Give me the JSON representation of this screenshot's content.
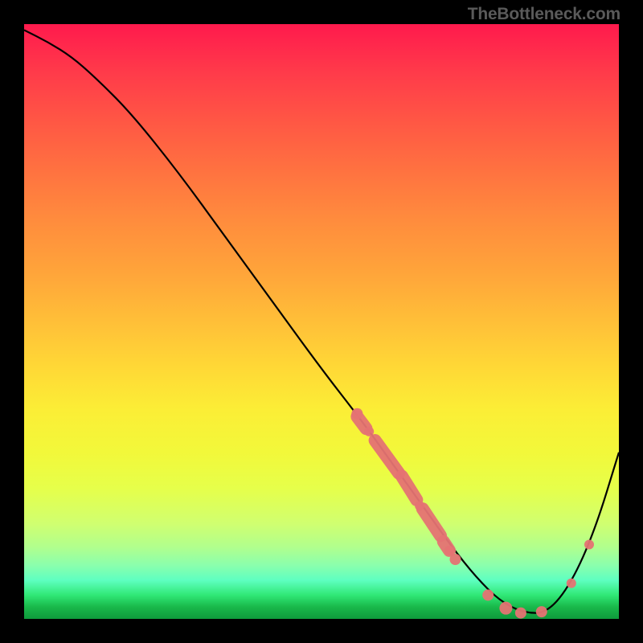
{
  "watermark": "TheBottleneck.com",
  "chart_data": {
    "type": "line",
    "title": "",
    "xlabel": "",
    "ylabel": "",
    "xlim": [
      0,
      100
    ],
    "ylim": [
      0,
      100
    ],
    "series": [
      {
        "name": "curve",
        "x": [
          0,
          4,
          8,
          12,
          18,
          26,
          34,
          42,
          50,
          57,
          62,
          67,
          72,
          76,
          80,
          84,
          88,
          92,
          96,
          100
        ],
        "y": [
          99,
          97,
          94.5,
          91,
          85,
          75,
          64,
          53,
          42,
          33,
          26,
          19,
          12,
          7,
          3,
          1,
          1,
          6,
          15,
          28
        ]
      }
    ],
    "highlight_segments": [
      {
        "x0": 56,
        "y0": 34,
        "x1": 57.5,
        "y1": 32
      },
      {
        "x0": 59,
        "y0": 30,
        "x1": 63,
        "y1": 24.5
      },
      {
        "x0": 63.5,
        "y0": 24,
        "x1": 66,
        "y1": 20
      },
      {
        "x0": 67,
        "y0": 18.5,
        "x1": 70,
        "y1": 14
      },
      {
        "x0": 70.5,
        "y0": 13,
        "x1": 71.5,
        "y1": 11.5
      }
    ],
    "highlight_points": [
      {
        "x": 56,
        "y": 34.5,
        "r": 7
      },
      {
        "x": 58,
        "y": 31.5,
        "r": 6
      },
      {
        "x": 66.5,
        "y": 19,
        "r": 6
      },
      {
        "x": 71.5,
        "y": 11.5,
        "r": 6
      },
      {
        "x": 72.5,
        "y": 10,
        "r": 7
      },
      {
        "x": 78,
        "y": 4,
        "r": 7
      },
      {
        "x": 81,
        "y": 1.8,
        "r": 8
      },
      {
        "x": 83.5,
        "y": 1,
        "r": 7
      },
      {
        "x": 87,
        "y": 1.2,
        "r": 7
      },
      {
        "x": 92,
        "y": 6,
        "r": 6
      },
      {
        "x": 95,
        "y": 12.5,
        "r": 6
      }
    ]
  }
}
